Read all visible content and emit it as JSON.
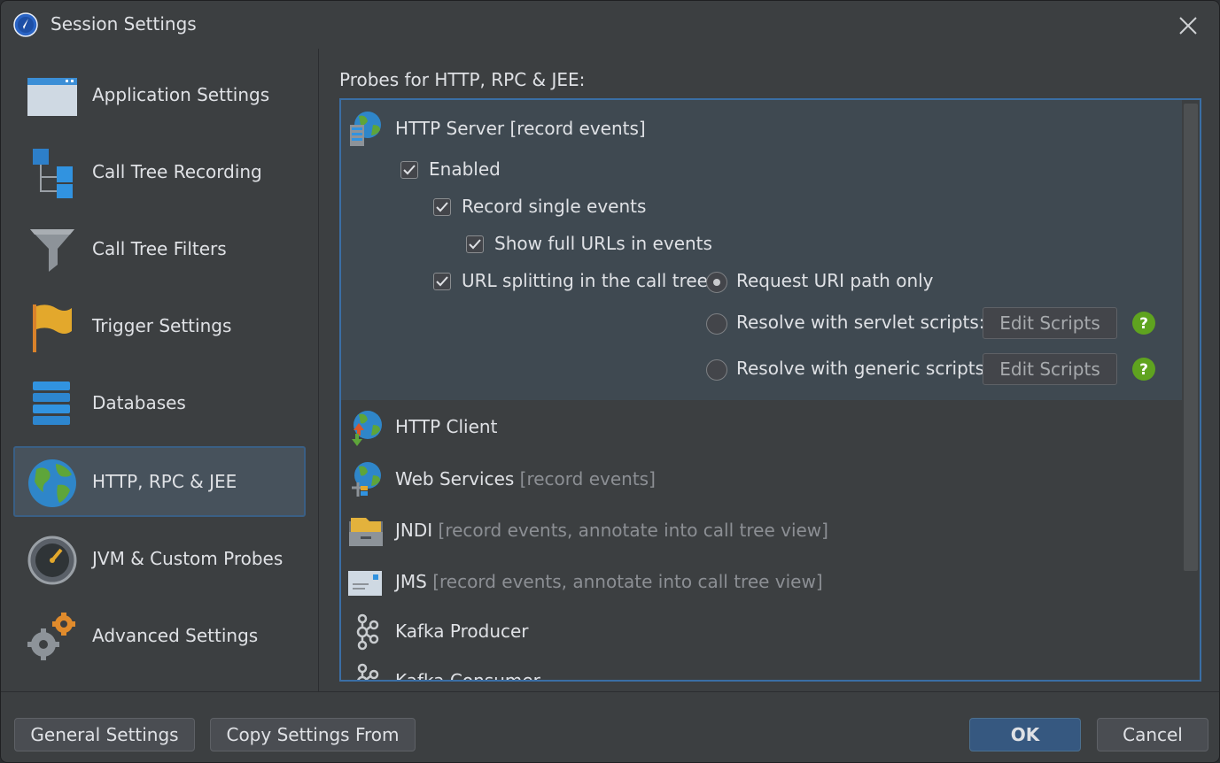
{
  "window": {
    "title": "Session Settings"
  },
  "sidebar": {
    "items": [
      {
        "label": "Application Settings",
        "icon": "application-window-icon"
      },
      {
        "label": "Call Tree Recording",
        "icon": "call-tree-icon"
      },
      {
        "label": "Call Tree Filters",
        "icon": "funnel-icon"
      },
      {
        "label": "Trigger Settings",
        "icon": "flag-icon"
      },
      {
        "label": "Databases",
        "icon": "database-icon"
      },
      {
        "label": "HTTP, RPC & JEE",
        "icon": "globe-icon",
        "selected": true
      },
      {
        "label": "JVM & Custom Probes",
        "icon": "gauge-icon"
      },
      {
        "label": "Advanced Settings",
        "icon": "gears-icon"
      }
    ]
  },
  "main": {
    "title": "Probes for HTTP, RPC & JEE:",
    "http_server": {
      "name": "HTTP Server",
      "tag": "[record events]",
      "enabled": {
        "label": "Enabled",
        "checked": true
      },
      "record_single": {
        "label": "Record single events",
        "checked": true
      },
      "full_urls": {
        "label": "Show full URLs in events",
        "checked": true
      },
      "url_splitting": {
        "label": "URL splitting in the call tree:",
        "checked": true
      },
      "radio_uri": {
        "label": "Request URI path only",
        "selected": true
      },
      "radio_servlet": {
        "label": "Resolve with servlet scripts:",
        "selected": false
      },
      "radio_generic": {
        "label": "Resolve with generic scripts:",
        "selected": false
      },
      "edit_scripts_label": "Edit Scripts"
    },
    "probes": [
      {
        "name": "HTTP Client",
        "tag": "",
        "icon": "http-client-globe-icon"
      },
      {
        "name": "Web Services",
        "tag": "[record events]",
        "icon": "web-services-globe-icon"
      },
      {
        "name": "JNDI",
        "tag": "[record events, annotate into call tree view]",
        "icon": "folder-drawer-icon"
      },
      {
        "name": "JMS",
        "tag": "[record events, annotate into call tree view]",
        "icon": "message-envelope-icon"
      },
      {
        "name": "Kafka Producer",
        "tag": "",
        "icon": "kafka-icon"
      },
      {
        "name": "Kafka Consumer",
        "tag": "",
        "icon": "kafka-icon"
      }
    ]
  },
  "footer": {
    "general_settings": "General Settings",
    "copy_settings": "Copy Settings From",
    "ok": "OK",
    "cancel": "Cancel"
  },
  "colors": {
    "background": "#3c3f41",
    "selection": "#47525c",
    "accent_border": "#3a6ea5",
    "primary_button": "#365880",
    "help_green": "#5fa31f"
  }
}
